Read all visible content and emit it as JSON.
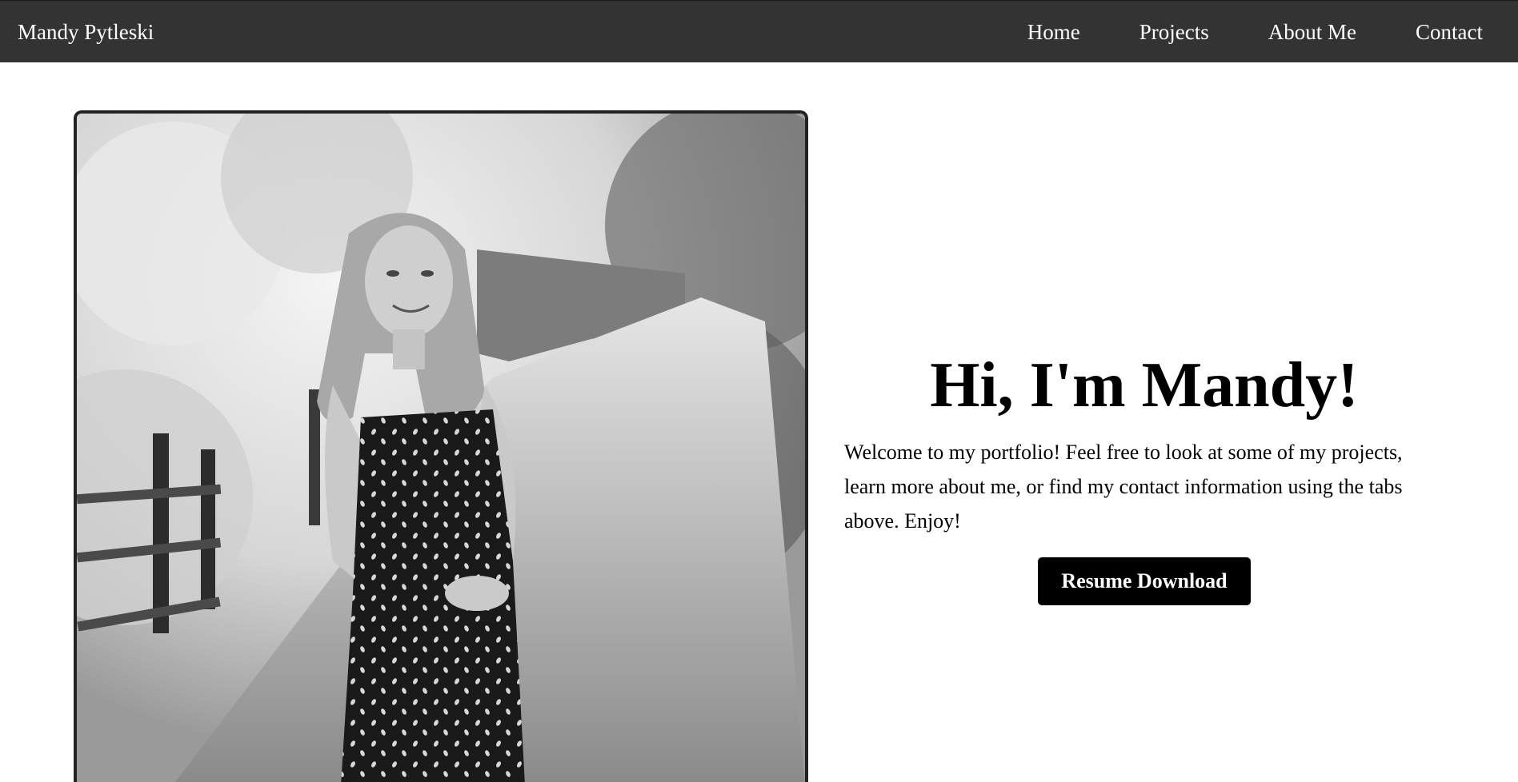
{
  "nav": {
    "brand": "Mandy Pytleski",
    "links": [
      {
        "label": "Home"
      },
      {
        "label": "Projects"
      },
      {
        "label": "About Me"
      },
      {
        "label": "Contact"
      }
    ]
  },
  "hero": {
    "photo_icon": "portrait-photo",
    "headline": "Hi, I'm Mandy!",
    "welcome": "Welcome to my portfolio! Feel free to look at some of my projects, learn more about me, or find my contact information using the tabs above. Enjoy!",
    "resume_button": "Resume Download"
  },
  "colors": {
    "navbar_bg": "#333333",
    "nav_text": "#ffffff",
    "button_bg": "#000000",
    "button_text": "#ffffff"
  }
}
